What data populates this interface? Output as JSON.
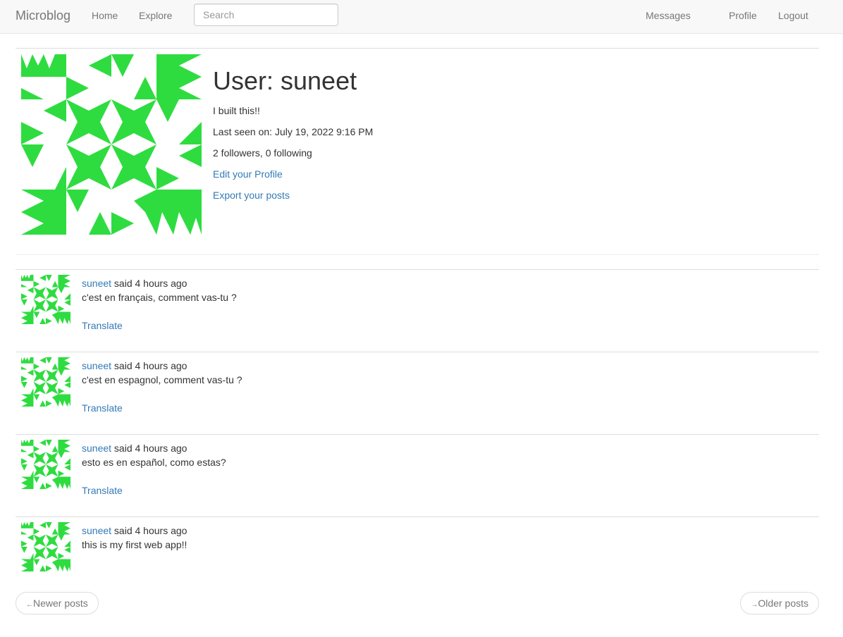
{
  "navbar": {
    "brand": "Microblog",
    "home": "Home",
    "explore": "Explore",
    "search_placeholder": "Search",
    "messages": "Messages",
    "profile": "Profile",
    "logout": "Logout"
  },
  "profile": {
    "title": "User: suneet",
    "about": "I built this!!",
    "last_seen": "Last seen on: July 19, 2022 9:16 PM",
    "follow_counts": "2 followers, 0 following",
    "edit_link": "Edit your Profile",
    "export_link": "Export your posts",
    "avatar_color": "#2edc40"
  },
  "posts": [
    {
      "author": "suneet",
      "said": " said 4 hours ago",
      "body": "c'est en français, comment vas-tu ?",
      "translate": "Translate"
    },
    {
      "author": "suneet",
      "said": " said 4 hours ago",
      "body": "c'est en espagnol, comment vas-tu ?",
      "translate": "Translate"
    },
    {
      "author": "suneet",
      "said": " said 4 hours ago",
      "body": "esto es en español, como estas?",
      "translate": "Translate"
    },
    {
      "author": "suneet",
      "said": " said 4 hours ago",
      "body": "this is my first web app!!"
    }
  ],
  "pager": {
    "newer_arrow": "←",
    "newer_label": "Newer posts",
    "older_arrow": "→",
    "older_label": "Older posts"
  }
}
